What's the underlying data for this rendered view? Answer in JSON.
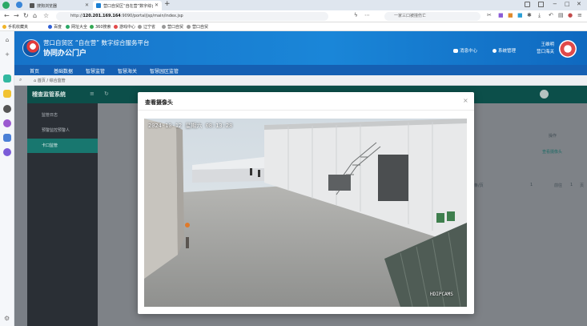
{
  "browser": {
    "tabs": [
      {
        "label": "搜狗浏览器",
        "active": false
      },
      {
        "label": "营口自贸区“自在营”数字综合服务",
        "active": true
      }
    ],
    "new_tab": "+",
    "window_controls": {
      "minimize": "−",
      "maximize": "□",
      "close": "✕"
    },
    "url_prefix": "http://",
    "url_host": "120.201.169.164",
    "url_path": ":9090/portal/jsp/main/index.jsp",
    "search_placeholder": "一家三口被撞伤亡",
    "bookmarks": [
      "手机收藏夹",
      "百度",
      "网址大全",
      "360搜索",
      "游戏中心",
      "辽宁省",
      "营口自贸",
      "营口自贸"
    ]
  },
  "portal": {
    "title": "营口自贸区 “自在营” 数字综合服务平台",
    "subtitle": "协同办公门户",
    "actions": {
      "message": "消息中心",
      "system": "系统管理"
    },
    "user": {
      "name": "王维明",
      "dept": "营口海关"
    },
    "nav": [
      "首页",
      "基础数据",
      "智慧监管",
      "智慧海关",
      "智慧园区监管"
    ],
    "breadcrumb": [
      "首页",
      "综合监管"
    ]
  },
  "app": {
    "title": "稽查监管系统",
    "sidebar": [
      {
        "label": "监管日志",
        "active": false
      },
      {
        "label": "预警监控预警人",
        "active": false
      },
      {
        "label": "卡口监管",
        "active": true
      }
    ],
    "bg_labels": {
      "operate": "操作",
      "view_camera": "查看摄像头",
      "per_page": "条/页",
      "page": "1",
      "goto": "前往",
      "page2": "1",
      "pages": "页"
    }
  },
  "modal": {
    "title": "查看摄像头",
    "close": "×",
    "camera_timestamp": "2024-10-12 星期六 08:13:28",
    "camera_label": "HDIPCAMS"
  },
  "colors": {
    "banner": "#1a7fd3",
    "nav": "#1560b3",
    "app_header": "#0c4f4a",
    "sidebar_active": "#18776f"
  }
}
